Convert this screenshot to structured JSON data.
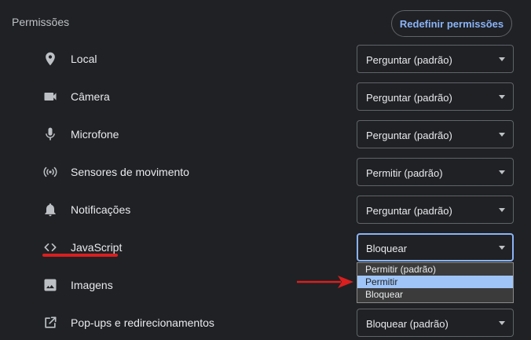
{
  "section": {
    "title": "Permissões"
  },
  "reset_button": {
    "label": "Redefinir permissões"
  },
  "permissions": [
    {
      "label": "Local",
      "value": "Perguntar (padrão)",
      "icon": "location-pin-icon"
    },
    {
      "label": "Câmera",
      "value": "Perguntar (padrão)",
      "icon": "camera-icon"
    },
    {
      "label": "Microfone",
      "value": "Perguntar (padrão)",
      "icon": "microphone-icon"
    },
    {
      "label": "Sensores de movimento",
      "value": "Permitir (padrão)",
      "icon": "motion-sensor-icon"
    },
    {
      "label": "Notificações",
      "value": "Perguntar (padrão)",
      "icon": "bell-icon"
    },
    {
      "label": "JavaScript",
      "value": "Bloquear",
      "icon": "code-brackets-icon"
    },
    {
      "label": "Imagens",
      "value": "",
      "icon": "image-icon"
    },
    {
      "label": "Pop-ups e redirecionamentos",
      "value": "Bloquear (padrão)",
      "icon": "popup-open-icon"
    }
  ],
  "javascript_dropdown": {
    "options": [
      "Permitir (padrão)",
      "Permitir",
      "Bloquear"
    ],
    "highlighted": "Permitir"
  },
  "colors": {
    "background": "#202124",
    "accent": "#8ab4f8",
    "annotation_red": "#d91f1f",
    "highlight": "#9fc5f8"
  }
}
